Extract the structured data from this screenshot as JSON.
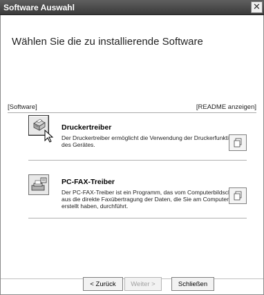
{
  "window": {
    "title": "Software Auswahl",
    "close_glyph": "✕"
  },
  "heading": "Wählen Sie die zu installierende Software",
  "columns": {
    "left": "[Software]",
    "right": "[README anzeigen]"
  },
  "items": [
    {
      "title": "Druckertreiber",
      "description": "Der Druckertreiber ermöglicht die Verwendung der Druckerfunktion des Gerätes.",
      "icon": "printer-icon",
      "readme_icon": "document-icon"
    },
    {
      "title": "PC-FAX-Treiber",
      "description": "Der PC-FAX-Treiber ist ein Programm, das vom Computerbildschirm aus die direkte Faxübertragung der Daten, die Sie am Computer erstellt haben, durchführt.",
      "icon": "fax-icon",
      "readme_icon": "document-icon"
    }
  ],
  "buttons": {
    "back": "< Zurück",
    "next": "Weiter >",
    "close": "Schließen"
  }
}
